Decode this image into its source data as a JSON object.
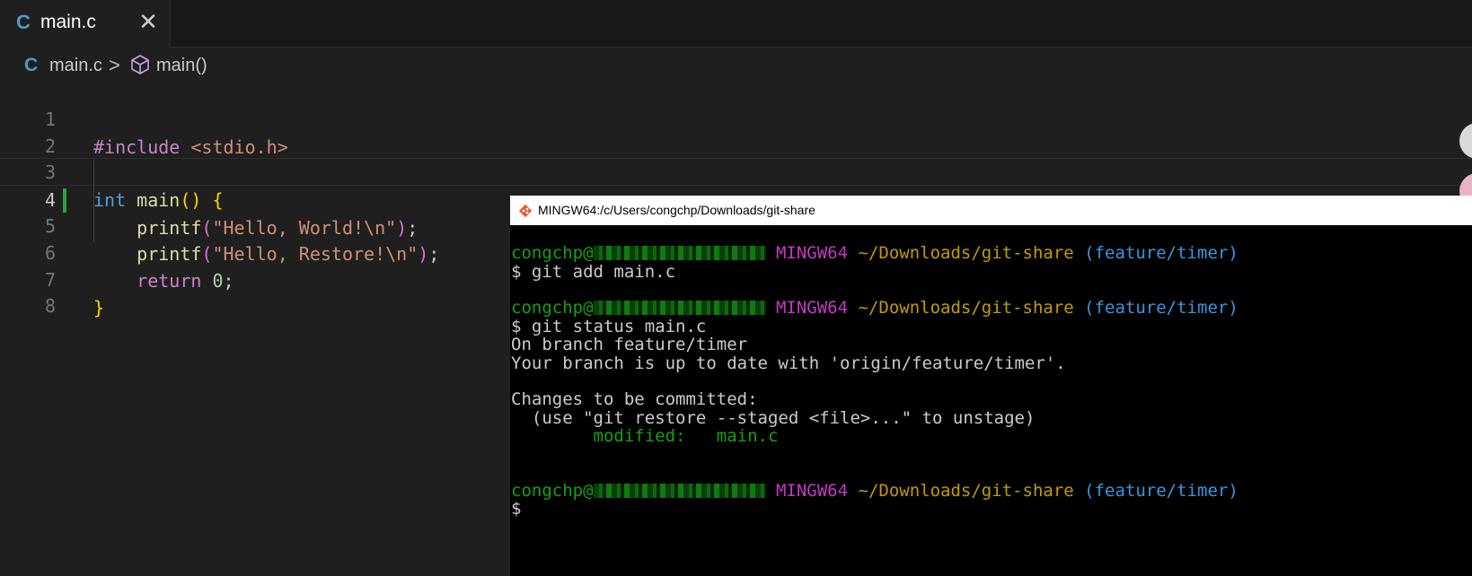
{
  "tab": {
    "icon": "C",
    "label": "main.c",
    "close": "✕"
  },
  "breadcrumb": {
    "icon": "C",
    "file": "main.c",
    "separator": ">",
    "symbol": "main()"
  },
  "editor": {
    "line_numbers": [
      "1",
      "2",
      "3",
      "4",
      "5",
      "6",
      "7",
      "8"
    ],
    "active_line": "4",
    "code": {
      "l1_directive": "#include",
      "l1_header": " <stdio.h>",
      "l3_type": "int",
      "l3_fn": "main",
      "l3_paren": "()",
      "l3_brace": "{",
      "l4_fn": "printf",
      "l4_open": "(",
      "l4_str": "\"Hello, World!\\n\"",
      "l4_close": ")",
      "l4_semi": ";",
      "l5_fn": "printf",
      "l5_open": "(",
      "l5_str": "\"Hello, Restore!\\n\"",
      "l5_close": ")",
      "l5_semi": ";",
      "l6_kw": "return",
      "l6_num": "0",
      "l6_semi": ";",
      "l7_brace": "}"
    }
  },
  "terminal": {
    "title": "MINGW64:/c/Users/congchp/Downloads/git-share",
    "prompt": {
      "user": "congchp@",
      "env": "MINGW64",
      "path": "~/Downloads/git-share",
      "branch": "(feature/timer)"
    },
    "cmd1": "$ git add main.c",
    "cmd2": "$ git status main.c",
    "out1": "On branch feature/timer",
    "out2": "Your branch is up to date with 'origin/feature/timer'.",
    "out3": "Changes to be committed:",
    "out4": "  (use \"git restore --staged <file>...\" to unstage)",
    "mod_label": "modified:",
    "mod_file": "main.c",
    "cmd3": "$"
  }
}
